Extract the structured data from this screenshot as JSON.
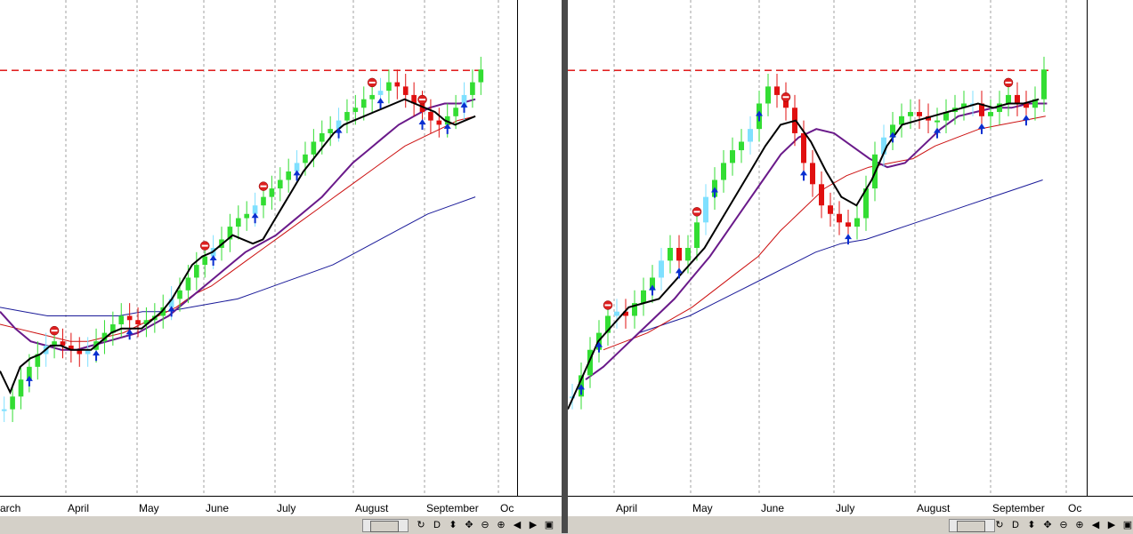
{
  "colors": {
    "up": "#33dd33",
    "up_light": "#7fe0ff",
    "down": "#e01010",
    "ma_black": "#000000",
    "ma_purple": "#6a1a8a",
    "ma_red": "#cc1010",
    "ma_blue": "#1a1a99",
    "resistance": "#dd0000",
    "grid": "#a0a0a0",
    "signal_arrow": "#0a2fd0",
    "stop_badge": "#dd2020"
  },
  "icons": [
    "zoom-in-icon",
    "D-icon",
    "updown-icon",
    "move-icon",
    "zoom-out-icon",
    "zoom-icon",
    "scroll-left-icon",
    "scroll-right-icon",
    "window-icon"
  ],
  "toolbar_labels": [
    "↻",
    "D",
    "⬍",
    "✥",
    "⊖",
    "⊕",
    "◀",
    "▶",
    "▣"
  ],
  "chart_data": [
    {
      "type": "candlestick",
      "months": [
        "arch",
        "April",
        "May",
        "June",
        "July",
        "August",
        "September",
        "Oc"
      ],
      "resistance_level": 0.918,
      "ylim": [
        0,
        1
      ],
      "grid": "vertical-dashed",
      "series": [
        {
          "name": "close",
          "values": [
            0.12,
            0.15,
            0.19,
            0.22,
            0.25,
            0.27,
            0.28,
            0.27,
            0.26,
            0.25,
            0.26,
            0.28,
            0.3,
            0.32,
            0.34,
            0.33,
            0.32,
            0.33,
            0.34,
            0.36,
            0.38,
            0.4,
            0.43,
            0.46,
            0.48,
            0.5,
            0.52,
            0.55,
            0.57,
            0.58,
            0.6,
            0.62,
            0.64,
            0.66,
            0.68,
            0.7,
            0.72,
            0.75,
            0.77,
            0.78,
            0.8,
            0.82,
            0.83,
            0.85,
            0.86,
            0.87,
            0.89,
            0.88,
            0.86,
            0.84,
            0.82,
            0.8,
            0.79,
            0.81,
            0.83,
            0.86,
            0.89,
            0.92
          ]
        },
        {
          "name": "ma_fast",
          "values": [
            0.21,
            0.16,
            0.22,
            0.24,
            0.25,
            0.27,
            0.27,
            0.26,
            0.26,
            0.26,
            0.28,
            0.3,
            0.31,
            0.31,
            0.31,
            0.33,
            0.35,
            0.38,
            0.42,
            0.46,
            0.48,
            0.49,
            0.51,
            0.53,
            0.52,
            0.51,
            0.52,
            0.56,
            0.6,
            0.64,
            0.68,
            0.71,
            0.74,
            0.77,
            0.79,
            0.8,
            0.81,
            0.82,
            0.83,
            0.84,
            0.85,
            0.84,
            0.83,
            0.82,
            0.8,
            0.79,
            0.8,
            0.81
          ]
        },
        {
          "name": "ma_purple",
          "values": [
            0.35,
            0.31,
            0.28,
            0.27,
            0.26,
            0.26,
            0.27,
            0.28,
            0.29,
            0.3,
            0.32,
            0.34,
            0.37,
            0.4,
            0.43,
            0.46,
            0.49,
            0.51,
            0.53,
            0.56,
            0.59,
            0.62,
            0.66,
            0.7,
            0.73,
            0.76,
            0.79,
            0.81,
            0.83,
            0.84,
            0.84,
            0.85
          ]
        },
        {
          "name": "ma_red",
          "values": [
            0.32,
            0.31,
            0.3,
            0.29,
            0.28,
            0.28,
            0.29,
            0.3,
            0.32,
            0.34,
            0.36,
            0.39,
            0.41,
            0.44,
            0.47,
            0.5,
            0.53,
            0.56,
            0.59,
            0.62,
            0.65,
            0.68,
            0.71,
            0.74,
            0.76,
            0.78,
            0.8,
            0.81
          ]
        },
        {
          "name": "ma_blue",
          "values": [
            0.36,
            0.35,
            0.34,
            0.34,
            0.34,
            0.34,
            0.35,
            0.35,
            0.36,
            0.37,
            0.38,
            0.4,
            0.42,
            0.44,
            0.46,
            0.49,
            0.52,
            0.55,
            0.58,
            0.6,
            0.62
          ]
        }
      ]
    },
    {
      "type": "candlestick",
      "months": [
        "April",
        "May",
        "June",
        "July",
        "August",
        "September",
        "Oc"
      ],
      "resistance_level": 0.918,
      "ylim": [
        0,
        1
      ],
      "grid": "vertical-dashed",
      "series": [
        {
          "name": "close",
          "values": [
            0.15,
            0.2,
            0.26,
            0.3,
            0.34,
            0.35,
            0.34,
            0.37,
            0.4,
            0.43,
            0.47,
            0.5,
            0.47,
            0.5,
            0.56,
            0.62,
            0.66,
            0.7,
            0.73,
            0.75,
            0.78,
            0.84,
            0.88,
            0.86,
            0.83,
            0.77,
            0.7,
            0.65,
            0.6,
            0.58,
            0.56,
            0.55,
            0.57,
            0.64,
            0.72,
            0.76,
            0.79,
            0.81,
            0.82,
            0.81,
            0.8,
            0.8,
            0.82,
            0.83,
            0.84,
            0.84,
            0.81,
            0.82,
            0.84,
            0.86,
            0.84,
            0.83,
            0.85,
            0.92
          ]
        },
        {
          "name": "ma_fast",
          "values": [
            0.12,
            0.2,
            0.28,
            0.32,
            0.36,
            0.37,
            0.38,
            0.42,
            0.46,
            0.5,
            0.56,
            0.62,
            0.68,
            0.74,
            0.79,
            0.8,
            0.75,
            0.68,
            0.62,
            0.6,
            0.66,
            0.74,
            0.79,
            0.8,
            0.81,
            0.82,
            0.83,
            0.84,
            0.83,
            0.84,
            0.84,
            0.85
          ]
        },
        {
          "name": "ma_purple",
          "values": [
            0.19,
            0.22,
            0.26,
            0.3,
            0.34,
            0.38,
            0.43,
            0.48,
            0.54,
            0.6,
            0.66,
            0.72,
            0.76,
            0.78,
            0.77,
            0.74,
            0.71,
            0.69,
            0.7,
            0.74,
            0.78,
            0.81,
            0.82,
            0.83,
            0.83,
            0.84,
            0.84
          ]
        },
        {
          "name": "ma_red",
          "values": [
            0.26,
            0.28,
            0.3,
            0.33,
            0.36,
            0.4,
            0.44,
            0.48,
            0.54,
            0.59,
            0.64,
            0.67,
            0.69,
            0.7,
            0.71,
            0.74,
            0.76,
            0.78,
            0.79,
            0.8,
            0.81
          ]
        },
        {
          "name": "ma_blue",
          "values": [
            0.3,
            0.32,
            0.34,
            0.37,
            0.4,
            0.43,
            0.46,
            0.49,
            0.51,
            0.52,
            0.54,
            0.56,
            0.58,
            0.6,
            0.62,
            0.64,
            0.66
          ]
        }
      ]
    }
  ]
}
